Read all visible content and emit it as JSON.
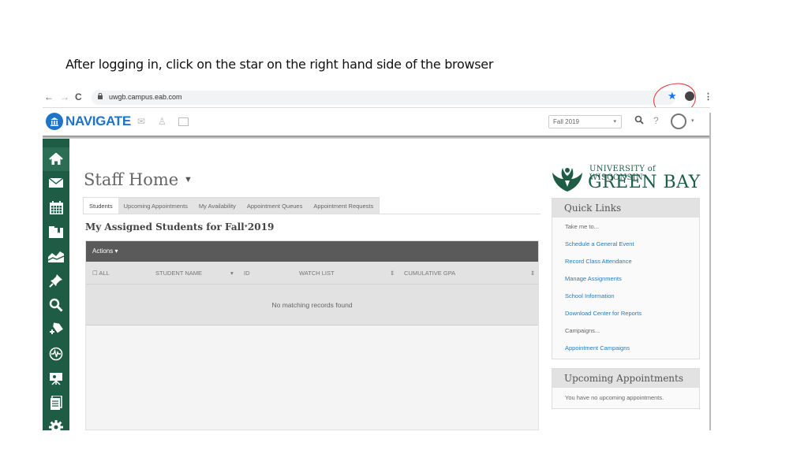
{
  "caption": "After logging in, click on the star on the right hand side of the browser",
  "browser": {
    "back_icon": "←",
    "forward_icon": "→",
    "reload_icon": "C",
    "url": "uwgb.campus.eab.com",
    "star_icon": "★",
    "menu_icon": "⋮"
  },
  "header": {
    "brand": "NAVIGATE",
    "term_select": "Fall 2019",
    "caret": "▾",
    "search_icon": "🔍",
    "help_icon": "?"
  },
  "sidebar": {
    "items": [
      {
        "name": "home",
        "icon": "⌂"
      },
      {
        "name": "messages",
        "icon": "✉"
      },
      {
        "name": "calendar",
        "icon": "▦"
      },
      {
        "name": "folder",
        "icon": "▬"
      },
      {
        "name": "reports",
        "icon": "◭"
      },
      {
        "name": "pin",
        "icon": "✎"
      },
      {
        "name": "search",
        "icon": "⚲"
      },
      {
        "name": "add-tag",
        "icon": "✚"
      },
      {
        "name": "activity",
        "icon": "◉"
      },
      {
        "name": "presentation",
        "icon": "⌸"
      },
      {
        "name": "documents",
        "icon": "▤"
      },
      {
        "name": "settings",
        "icon": "✱"
      }
    ]
  },
  "main": {
    "page_title": "Staff Home",
    "title_caret": "▼",
    "tabs": [
      {
        "label": "Students",
        "active": true
      },
      {
        "label": "Upcoming Appointments",
        "active": false
      },
      {
        "label": "My Availability",
        "active": false
      },
      {
        "label": "Appointment Queues",
        "active": false
      },
      {
        "label": "Appointment Requests",
        "active": false
      }
    ],
    "section_title": "My Assigned Students for Fall 2019",
    "section_caret": "▾",
    "table": {
      "actions_label": "Actions ▾",
      "columns": [
        {
          "label": "☐ ALL"
        },
        {
          "label": "STUDENT NAME"
        },
        {
          "label": "▾"
        },
        {
          "label": "ID"
        },
        {
          "label": "WATCH LIST"
        },
        {
          "label": "⇕"
        },
        {
          "label": "CUMULATIVE GPA"
        },
        {
          "label": "⇕"
        }
      ],
      "empty_message": "No matching records found"
    }
  },
  "right": {
    "logo_line1": "UNIVERSITY of WISCONSIN",
    "logo_line2": "GREEN BAY",
    "quick_links": {
      "title": "Quick Links",
      "rows": [
        {
          "text": "Take me to...",
          "type": "label"
        },
        {
          "text": "Schedule a General Event",
          "type": "link"
        },
        {
          "text": "Record Class Attendance",
          "type": "link"
        },
        {
          "text": "Manage Assignments",
          "type": "link"
        },
        {
          "text": "School Information",
          "type": "link"
        },
        {
          "text": "Download Center for Reports",
          "type": "link"
        },
        {
          "text": "Campaigns...",
          "type": "label"
        },
        {
          "text": "Appointment Campaigns",
          "type": "link"
        }
      ]
    },
    "upcoming": {
      "title": "Upcoming Appointments",
      "message": "You have no upcoming appointments."
    }
  },
  "colors": {
    "brand_blue": "#1d74c9",
    "sidebar_green": "#1f5c45",
    "link_blue": "#2a7ab8",
    "annotation_red": "#e03030"
  }
}
